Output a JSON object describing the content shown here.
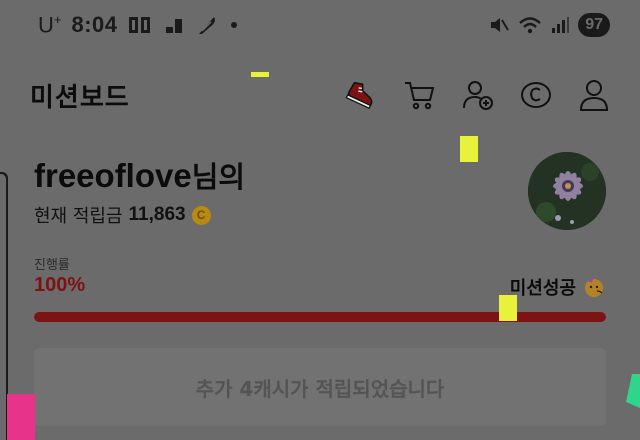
{
  "status_bar": {
    "carrier": "U",
    "carrier_sup": "+",
    "time": "8:04",
    "battery": "97"
  },
  "header": {
    "title": "미션보드",
    "icons": [
      "sneaker-icon",
      "cart-icon",
      "add-friend-icon",
      "coin-c-icon",
      "profile-icon"
    ]
  },
  "profile": {
    "username": "freeoflove",
    "username_suffix": "님의",
    "points_label": "현재 적립금",
    "points_value": "11,863",
    "coin_symbol": "C"
  },
  "progress": {
    "caption": "진행률",
    "percent_text": "100%",
    "percent_value": 100,
    "status_text": "미션성공",
    "fill_color": "#7d1414"
  },
  "earned_button": {
    "label": "추가 4캐시가 적립되었습니다"
  },
  "colors": {
    "overlay": "#6b6b6b",
    "accent_red": "#7d1212",
    "marker_yellow": "#e8f23a",
    "marker_pink": "#e8338a",
    "marker_green": "#2fd58a"
  }
}
